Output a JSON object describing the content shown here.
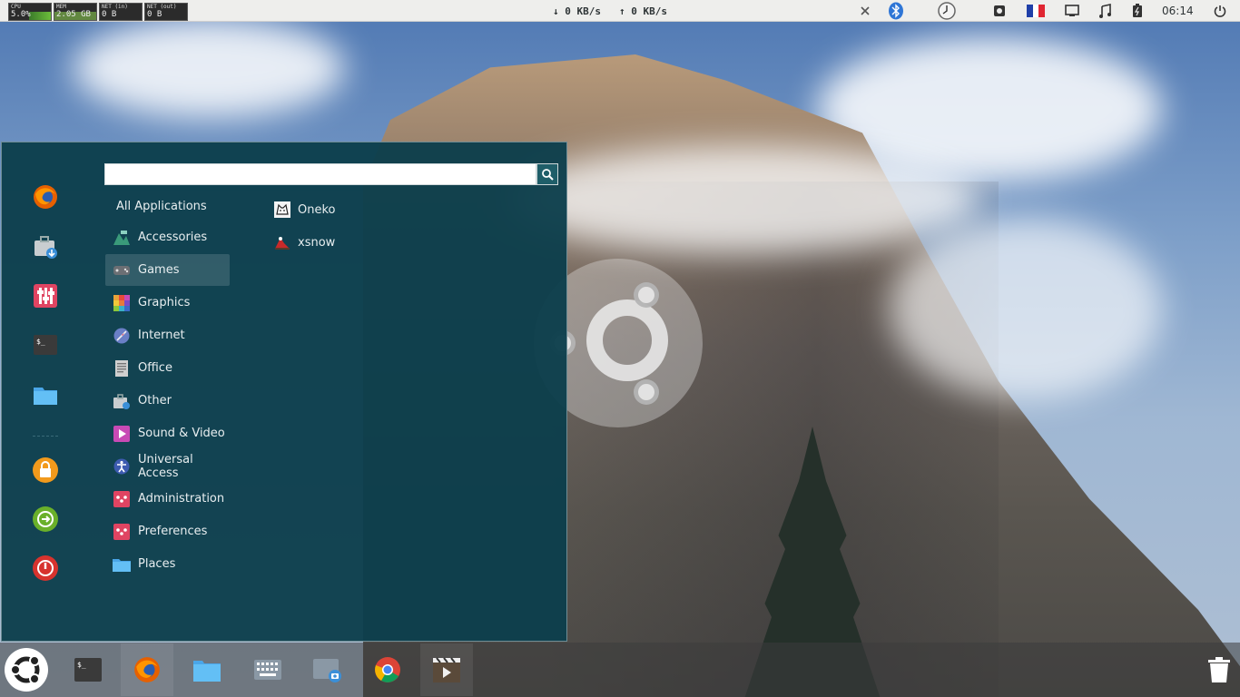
{
  "top_panel": {
    "monitors": [
      {
        "label": "CPU",
        "value": "5.0%",
        "kind": "cpu"
      },
      {
        "label": "MEM",
        "value": "2.05 GB",
        "kind": "mem"
      },
      {
        "label": "NET (in)",
        "value": "0 B",
        "kind": "net"
      },
      {
        "label": "NET (out)",
        "value": "0 B",
        "kind": "net"
      }
    ],
    "net_down": "↓ 0 KB/s",
    "net_up": "↑ 0 KB/s",
    "clock": "06:14",
    "tray_icons": [
      "close-icon",
      "bluetooth-icon",
      "clock-applet-icon",
      "screenshot-icon",
      "keyboard-layout-fr-icon",
      "display-icon",
      "music-icon",
      "battery-icon",
      "power-icon"
    ]
  },
  "menu": {
    "search": {
      "value": "",
      "placeholder": ""
    },
    "favorites": [
      "firefox-icon",
      "software-center-icon",
      "settings-icon",
      "terminal-icon",
      "folder-icon",
      "separator",
      "lock-icon",
      "logout-icon",
      "shutdown-icon"
    ],
    "all_applications": "All Applications",
    "categories": [
      {
        "label": "Accessories",
        "icon": "accessories-icon",
        "color": "#3a9a7a"
      },
      {
        "label": "Games",
        "icon": "games-icon",
        "color": "#6c6f74"
      },
      {
        "label": "Graphics",
        "icon": "graphics-icon",
        "color": "#e8a33a"
      },
      {
        "label": "Internet",
        "icon": "internet-icon",
        "color": "#6a7fc6"
      },
      {
        "label": "Office",
        "icon": "office-icon",
        "color": "#9a9a9a"
      },
      {
        "label": "Other",
        "icon": "other-icon",
        "color": "#9aa6ad"
      },
      {
        "label": "Sound & Video",
        "icon": "sound-video-icon",
        "color": "#c84ab5"
      },
      {
        "label": "Universal Access",
        "icon": "universal-access-icon",
        "color": "#3d5bb0"
      },
      {
        "label": "Administration",
        "icon": "administration-icon",
        "color": "#e04462"
      },
      {
        "label": "Preferences",
        "icon": "preferences-icon",
        "color": "#e04462"
      },
      {
        "label": "Places",
        "icon": "places-icon",
        "color": "#5ab0e8"
      }
    ],
    "active_category": "Games",
    "apps": [
      {
        "label": "Oneko",
        "icon": "oneko-cat-icon"
      },
      {
        "label": "xsnow",
        "icon": "xsnow-santa-icon"
      }
    ]
  },
  "dock": {
    "items": [
      "ubuntu-menu-icon",
      "terminal-icon",
      "firefox-icon",
      "files-icon",
      "keyboard-icon",
      "screenshot-icon",
      "chrome-icon",
      "video-editor-icon"
    ],
    "trash": "trash-icon"
  },
  "colors": {
    "menu_bg": "#0d3e4c",
    "panel_bg": "#eeeeec",
    "accent": "#1f5e69"
  }
}
